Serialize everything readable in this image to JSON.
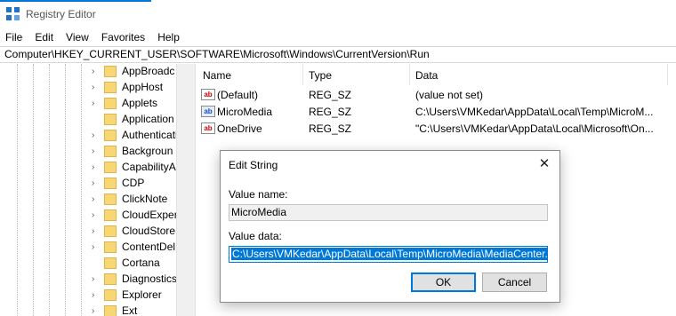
{
  "window": {
    "title": "Registry Editor"
  },
  "menu": [
    "File",
    "Edit",
    "View",
    "Favorites",
    "Help"
  ],
  "address": "Computer\\HKEY_CURRENT_USER\\SOFTWARE\\Microsoft\\Windows\\CurrentVersion\\Run",
  "tree": {
    "items": [
      {
        "label": "AppBroadc",
        "expandable": true
      },
      {
        "label": "AppHost",
        "expandable": true
      },
      {
        "label": "Applets",
        "expandable": true
      },
      {
        "label": "Application",
        "expandable": false
      },
      {
        "label": "Authenticati",
        "expandable": true
      },
      {
        "label": "Backgroun",
        "expandable": true
      },
      {
        "label": "CapabilityA",
        "expandable": true
      },
      {
        "label": "CDP",
        "expandable": true
      },
      {
        "label": "ClickNote",
        "expandable": true
      },
      {
        "label": "CloudExper",
        "expandable": true
      },
      {
        "label": "CloudStore",
        "expandable": true
      },
      {
        "label": "ContentDel",
        "expandable": true
      },
      {
        "label": "Cortana",
        "expandable": false
      },
      {
        "label": "Diagnostics",
        "expandable": true
      },
      {
        "label": "Explorer",
        "expandable": true
      },
      {
        "label": "Ext",
        "expandable": true
      }
    ]
  },
  "list": {
    "columns": [
      "Name",
      "Type",
      "Data"
    ],
    "rows": [
      {
        "icon": "string-value-icon",
        "badge": "ab",
        "name": "(Default)",
        "type": "REG_SZ",
        "data": "(value not set)"
      },
      {
        "icon": "binary-value-icon",
        "badge": "ab",
        "name": "MicroMedia",
        "type": "REG_SZ",
        "data": "C:\\Users\\VMKedar\\AppData\\Local\\Temp\\MicroM..."
      },
      {
        "icon": "string-value-icon",
        "badge": "ab",
        "name": "OneDrive",
        "type": "REG_SZ",
        "data": "\"C:\\Users\\VMKedar\\AppData\\Local\\Microsoft\\On..."
      }
    ]
  },
  "dialog": {
    "title": "Edit String",
    "close_glyph": "✕",
    "value_name_label": "Value name:",
    "value_name": "MicroMedia",
    "value_data_label": "Value data:",
    "value_data": "C:\\Users\\VMKedar\\AppData\\Local\\Temp\\MicroMedia\\MediaCenter.exe",
    "ok_label": "OK",
    "cancel_label": "Cancel"
  },
  "colors": {
    "accent": "#0078d7",
    "folder": "#f7d774"
  }
}
